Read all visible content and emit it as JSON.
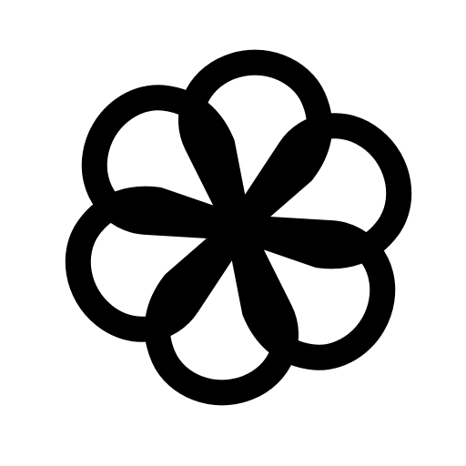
{
  "logo": {
    "icon": "pinwheel-flower-icon",
    "petal_count": 6,
    "stroke_color": "#000000",
    "background_color": "#ffffff"
  }
}
